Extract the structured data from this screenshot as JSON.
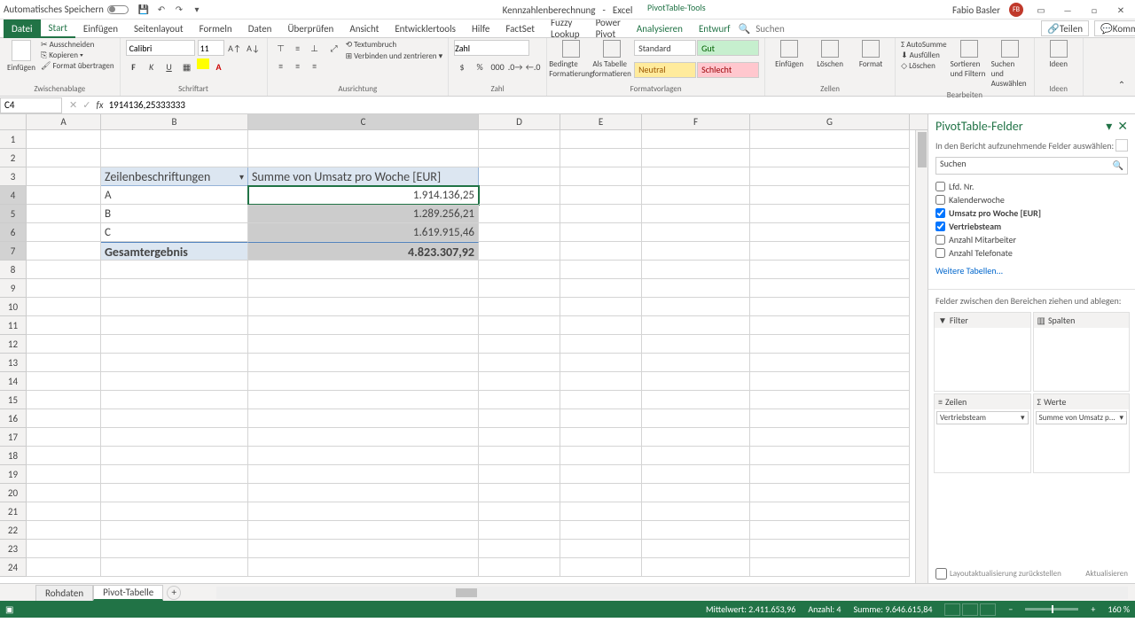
{
  "titleBar": {
    "autoSave": "Automatisches Speichern",
    "docTitle": "Kennzahlenberechnung",
    "appName": "Excel",
    "pivotTools": "PivotTable-Tools",
    "user": "Fabio Basler",
    "userInitials": "FB"
  },
  "tabs": {
    "file": "Datei",
    "start": "Start",
    "einfugen": "Einfügen",
    "seitenlayout": "Seitenlayout",
    "formeln": "Formeln",
    "daten": "Daten",
    "uberprufen": "Überprüfen",
    "ansicht": "Ansicht",
    "entwickler": "Entwicklertools",
    "hilfe": "Hilfe",
    "factset": "FactSet",
    "fuzzy": "Fuzzy Lookup",
    "powerpivot": "Power Pivot",
    "analysieren": "Analysieren",
    "entwurf": "Entwurf",
    "search": "Suchen",
    "teilen": "Teilen",
    "kommentare": "Kommentare"
  },
  "ribbon": {
    "paste": "Einfügen",
    "cut": "Ausschneiden",
    "copy": "Kopieren",
    "format": "Format übertragen",
    "clipboard": "Zwischenablage",
    "font": "Calibri",
    "size": "11",
    "fontGroup": "Schriftart",
    "alignGroup": "Ausrichtung",
    "wrap": "Textumbruch",
    "merge": "Verbinden und zentrieren",
    "numFormat": "Zahl",
    "numGroup": "Zahl",
    "bedingte": "Bedingte Formatierung",
    "alsTabelle": "Als Tabelle formatieren",
    "std": "Standard",
    "gut": "Gut",
    "neu": "Neutral",
    "bad": "Schlecht",
    "styleGroup": "Formatvorlagen",
    "ins": "Einfügen",
    "del": "Löschen",
    "fmt": "Format",
    "cellGroup": "Zellen",
    "sum": "AutoSumme",
    "fill": "Ausfüllen",
    "clear": "Löschen",
    "sort": "Sortieren und Filtern",
    "find": "Suchen und Auswählen",
    "editGroup": "Bearbeiten",
    "ideas": "Ideen",
    "ideasGroup": "Ideen"
  },
  "nameBox": {
    "ref": "C4",
    "formula": "1914136,25333333"
  },
  "cols": [
    "A",
    "B",
    "C",
    "D",
    "E",
    "F",
    "G"
  ],
  "pivot": {
    "rowHeader": "Zeilenbeschriftungen",
    "valHeader": "Summe von Umsatz pro Woche [EUR]",
    "rows": [
      {
        "label": "A",
        "value": "1.914.136,25"
      },
      {
        "label": "B",
        "value": "1.289.256,21"
      },
      {
        "label": "C",
        "value": "1.619.915,46"
      }
    ],
    "totalLabel": "Gesamtergebnis",
    "totalValue": "4.823.307,92"
  },
  "pane": {
    "title": "PivotTable-Felder",
    "sub": "In den Bericht aufzunehmende Felder auswählen:",
    "search": "Suchen",
    "fields": [
      {
        "name": "Lfd. Nr.",
        "checked": false
      },
      {
        "name": "Kalenderwoche",
        "checked": false
      },
      {
        "name": "Umsatz pro Woche [EUR]",
        "checked": true
      },
      {
        "name": "Vertriebsteam",
        "checked": true
      },
      {
        "name": "Anzahl Mitarbeiter",
        "checked": false
      },
      {
        "name": "Anzahl Telefonate",
        "checked": false
      }
    ],
    "more": "Weitere Tabellen...",
    "dragHint": "Felder zwischen den Bereichen ziehen und ablegen:",
    "filter": "Filter",
    "cols": "Spalten",
    "rows": "Zeilen",
    "vals": "Werte",
    "rowItem": "Vertriebsteam",
    "valItem": "Summe von Umsatz p...",
    "defer": "Layoutaktualisierung zurückstellen",
    "update": "Aktualisieren"
  },
  "sheets": {
    "s1": "Rohdaten",
    "s2": "Pivot-Tabelle"
  },
  "status": {
    "mean": "Mittelwert: 2.411.653,96",
    "count": "Anzahl: 4",
    "sum": "Summe: 9.646.615,84",
    "zoom": "160 %"
  }
}
